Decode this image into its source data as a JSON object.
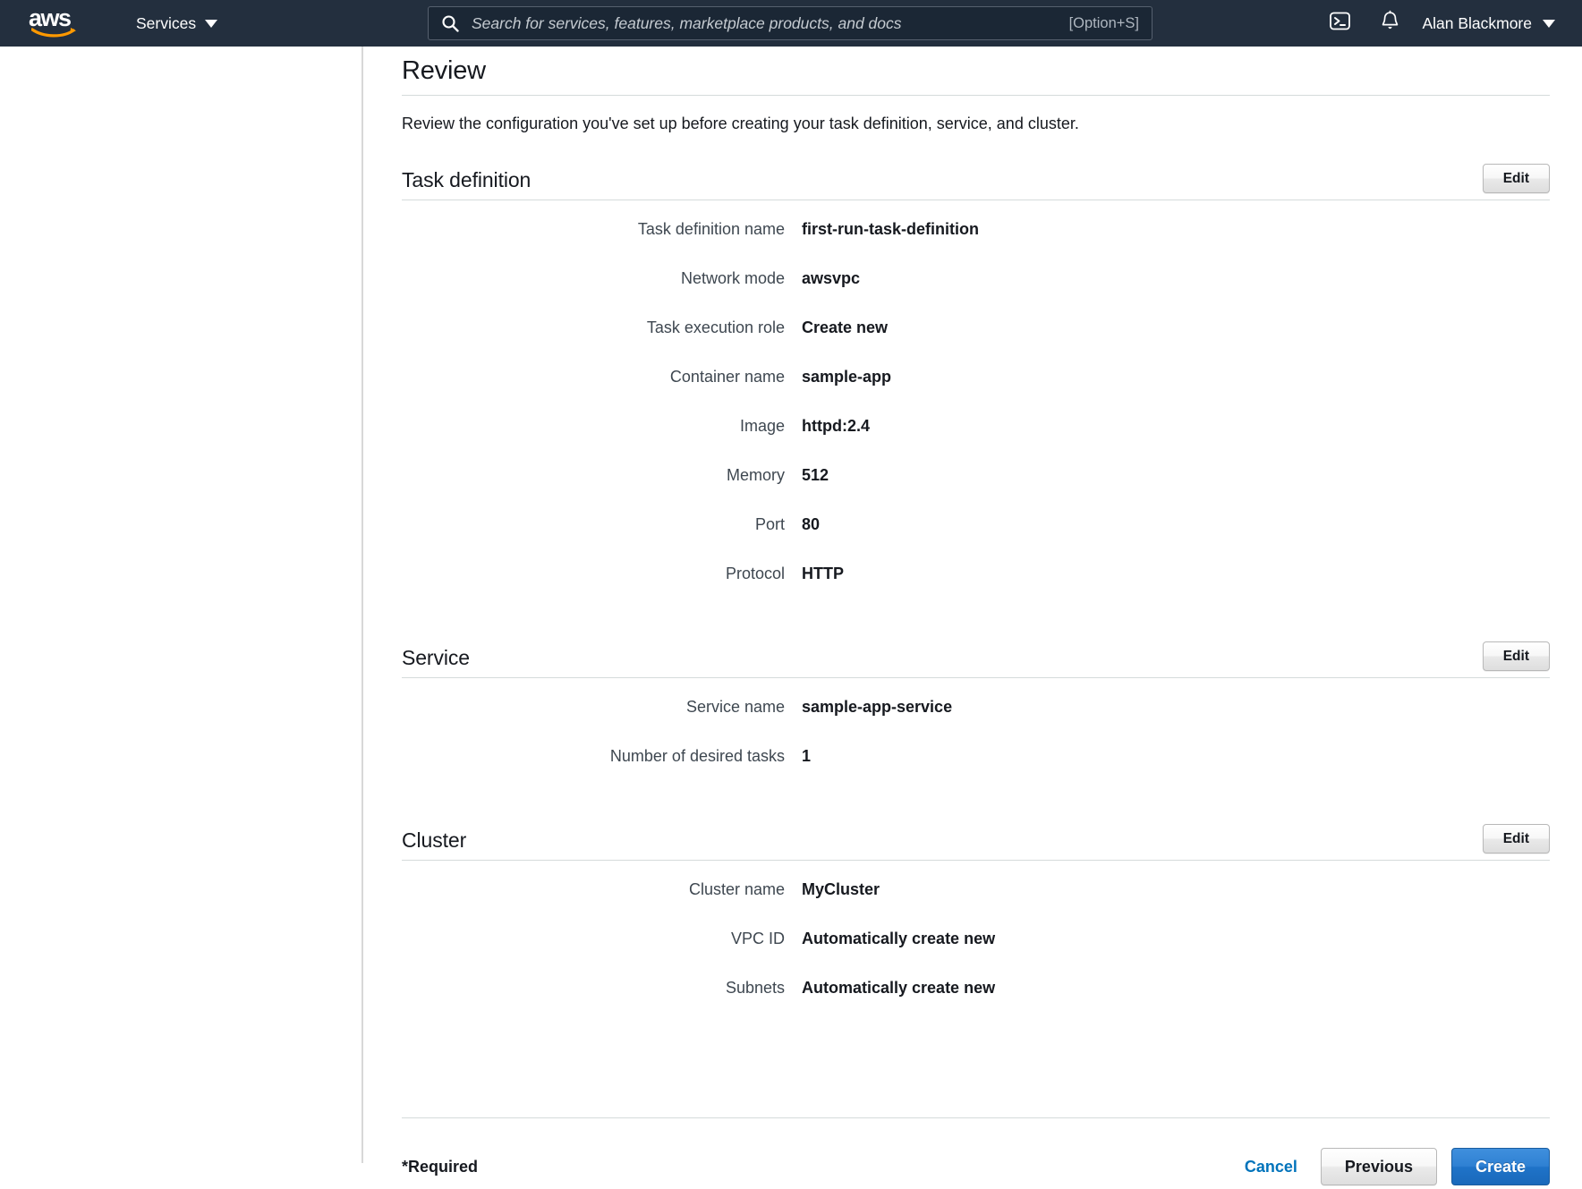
{
  "topnav": {
    "logo_text": "aws",
    "services_label": "Services",
    "search": {
      "placeholder": "Search for services, features, marketplace products, and docs",
      "value": "",
      "shortcut": "[Option+S]",
      "icon": "search-icon"
    },
    "cloudshell_icon": "terminal-icon",
    "notifications_icon": "bell-icon",
    "user_name": "Alan Blackmore"
  },
  "page": {
    "title": "Review",
    "description": "Review the configuration you've set up before creating your task definition, service, and cluster."
  },
  "sections": [
    {
      "id": "task-definition",
      "title": "Task definition",
      "edit_label": "Edit",
      "rows": [
        {
          "label": "Task definition name",
          "value": "first-run-task-definition"
        },
        {
          "label": "Network mode",
          "value": "awsvpc"
        },
        {
          "label": "Task execution role",
          "value": "Create new"
        },
        {
          "label": "Container name",
          "value": "sample-app"
        },
        {
          "label": "Image",
          "value": "httpd:2.4"
        },
        {
          "label": "Memory",
          "value": "512"
        },
        {
          "label": "Port",
          "value": "80"
        },
        {
          "label": "Protocol",
          "value": "HTTP"
        }
      ]
    },
    {
      "id": "service",
      "title": "Service",
      "edit_label": "Edit",
      "rows": [
        {
          "label": "Service name",
          "value": "sample-app-service"
        },
        {
          "label": "Number of desired tasks",
          "value": "1"
        }
      ]
    },
    {
      "id": "cluster",
      "title": "Cluster",
      "edit_label": "Edit",
      "rows": [
        {
          "label": "Cluster name",
          "value": "MyCluster"
        },
        {
          "label": "VPC ID",
          "value": "Automatically create new"
        },
        {
          "label": "Subnets",
          "value": "Automatically create new"
        }
      ]
    }
  ],
  "footer": {
    "required_note": "*Required",
    "cancel_label": "Cancel",
    "previous_label": "Previous",
    "create_label": "Create"
  },
  "colors": {
    "nav_background": "#232f3e",
    "logo_orange": "#ff9900",
    "link_blue": "#0073bb",
    "primary_button": "#2f81d3",
    "text_primary": "#16191f",
    "text_label": "#3e4750",
    "rule": "#d5dbdb"
  }
}
